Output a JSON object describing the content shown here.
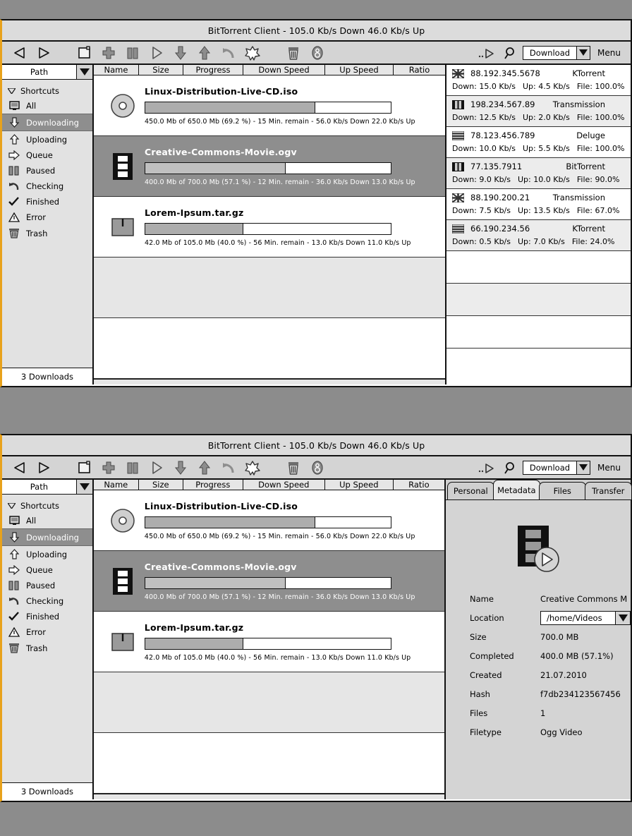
{
  "window": {
    "title": "BitTorrent Client - 105.0 Kb/s Down 46.0 Kb/s Up",
    "accent_color": "#e8a21c",
    "selection_color": "#8e8e8e",
    "background_color": "#8c8c8c"
  },
  "toolbar": {
    "icons": [
      {
        "name": "back-arrow-icon",
        "label": "Back"
      },
      {
        "name": "forward-arrow-icon",
        "label": "Forward"
      },
      {
        "name": "new-torrent-icon",
        "label": "New"
      },
      {
        "name": "add-plus-icon",
        "label": "Add"
      },
      {
        "name": "pause-icon",
        "label": "Pause"
      },
      {
        "name": "play-icon",
        "label": "Start"
      },
      {
        "name": "download-arrow-icon",
        "label": "Download"
      },
      {
        "name": "upload-arrow-icon",
        "label": "Upload"
      },
      {
        "name": "undo-icon",
        "label": "Undo"
      },
      {
        "name": "cancel-burst-icon",
        "label": "Cancel"
      },
      {
        "name": "trash-icon",
        "label": "Remove"
      },
      {
        "name": "info-icon",
        "label": "Info"
      }
    ],
    "right_icons": [
      {
        "name": "skip-play-icon",
        "label": "Skip"
      },
      {
        "name": "search-icon",
        "label": "Search"
      }
    ],
    "filter_combo": {
      "value": "Download",
      "arrow": "chevron-down-icon"
    },
    "menu_label": "Menu"
  },
  "sidebar": {
    "path_header": {
      "label": "Path",
      "arrow": "chevron-down-icon"
    },
    "group_label": "Shortcuts",
    "group_arrow": "triangle-down-icon",
    "items": [
      {
        "label": "All",
        "icon": "monitor-icon",
        "active": false
      },
      {
        "label": "Downloading",
        "icon": "download-arrow-icon",
        "active": true
      },
      {
        "label": "Uploading",
        "icon": "upload-arrow-icon",
        "active": false
      },
      {
        "label": "Queue",
        "icon": "right-arrow-icon",
        "active": false
      },
      {
        "label": "Paused",
        "icon": "pause-icon",
        "active": false
      },
      {
        "label": "Checking",
        "icon": "refresh-icon",
        "active": false
      },
      {
        "label": "Finished",
        "icon": "checkmark-icon",
        "active": false
      },
      {
        "label": "Error",
        "icon": "warning-triangle-icon",
        "active": false
      },
      {
        "label": "Trash",
        "icon": "trash-icon",
        "active": false
      }
    ],
    "status": "3 Downloads"
  },
  "list": {
    "columns": [
      "Name",
      "Size",
      "Progress",
      "Down Speed",
      "Up Speed",
      "Ratio"
    ],
    "rows": [
      {
        "name": "Linux-Distribution-Live-CD.iso",
        "icon": "cd-disc-icon",
        "progress_percent": 69.2,
        "meta": "450.0 Mb of 650.0 Mb (69.2 %) - 15 Min. remain - 56.0 Kb/s Down  22.0 Kb/s Up",
        "selected": false
      },
      {
        "name": "Creative-Commons-Movie.ogv",
        "icon": "film-strip-icon",
        "progress_percent": 57.1,
        "meta": "400.0 Mb of 700.0 Mb (57.1 %) - 12 Min. remain - 36.0 Kb/s Down  13.0 Kb/s Up",
        "selected": true
      },
      {
        "name": "Lorem-Ipsum.tar.gz",
        "icon": "archive-box-icon",
        "progress_percent": 40.0,
        "meta": "42.0 Mb of 105.0 Mb (40.0 %) - 56 Min. remain - 13.0 Kb/s Down  11.0 Kb/s Up",
        "selected": false
      }
    ]
  },
  "peers": {
    "rows": [
      {
        "flag": "uk-flag-icon",
        "address": "88.192.345.5678",
        "client": "KTorrent",
        "down": "Down: 15.0 Kb/s",
        "up": "Up: 4.5 Kb/s",
        "file": "File: 100.0%"
      },
      {
        "flag": "pause-bars-icon",
        "address": "198.234.567.89",
        "client": "Transmission",
        "down": "Down: 12.5 Kb/s",
        "up": "Up: 2.0 Kb/s",
        "file": "File: 100.0%"
      },
      {
        "flag": "stripes-flag-icon",
        "address": "78.123.456.789",
        "client": "Deluge",
        "down": "Down: 10.0 Kb/s",
        "up": "Up: 5.5 Kb/s",
        "file": "File: 100.0%"
      },
      {
        "flag": "pause-bars-icon",
        "address": "77.135.7911",
        "client": "BitTorrent",
        "down": "Down: 9.0 Kb/s",
        "up": "Up: 10.0 Kb/s",
        "file": "File:  90.0%"
      },
      {
        "flag": "uk-flag-icon",
        "address": "88.190.200.21",
        "client": "Transmission",
        "down": "Down: 7.5 Kb/s",
        "up": "Up: 13.5 Kb/s",
        "file": "File:  67.0%"
      },
      {
        "flag": "stripes-flag-icon",
        "address": "66.190.234.56",
        "client": "KTorrent",
        "down": "Down: 0.5 Kb/s",
        "up": "Up: 7.0 Kb/s",
        "file": "File:  24.0%"
      }
    ]
  },
  "details": {
    "tabs": [
      {
        "label": "Personal",
        "active": false
      },
      {
        "label": "Metadata",
        "active": true
      },
      {
        "label": "Files",
        "active": false
      },
      {
        "label": "Transfer",
        "active": false
      }
    ],
    "preview_icon": "film-strip-play-icon",
    "fields": [
      {
        "label": "Name",
        "value": "Creative Commons M",
        "type": "text"
      },
      {
        "label": "Location",
        "value": "/home/Videos",
        "type": "combo"
      },
      {
        "label": "Size",
        "value": "700.0 MB",
        "type": "text"
      },
      {
        "label": "Completed",
        "value": "400.0 MB (57.1%)",
        "type": "text"
      },
      {
        "label": "Created",
        "value": "21.07.2010",
        "type": "text"
      },
      {
        "label": "Hash",
        "value": "f7db234123567456",
        "type": "text"
      },
      {
        "label": "Files",
        "value": "1",
        "type": "text"
      },
      {
        "label": "Filetype",
        "value": "Ogg Video",
        "type": "text"
      }
    ]
  }
}
